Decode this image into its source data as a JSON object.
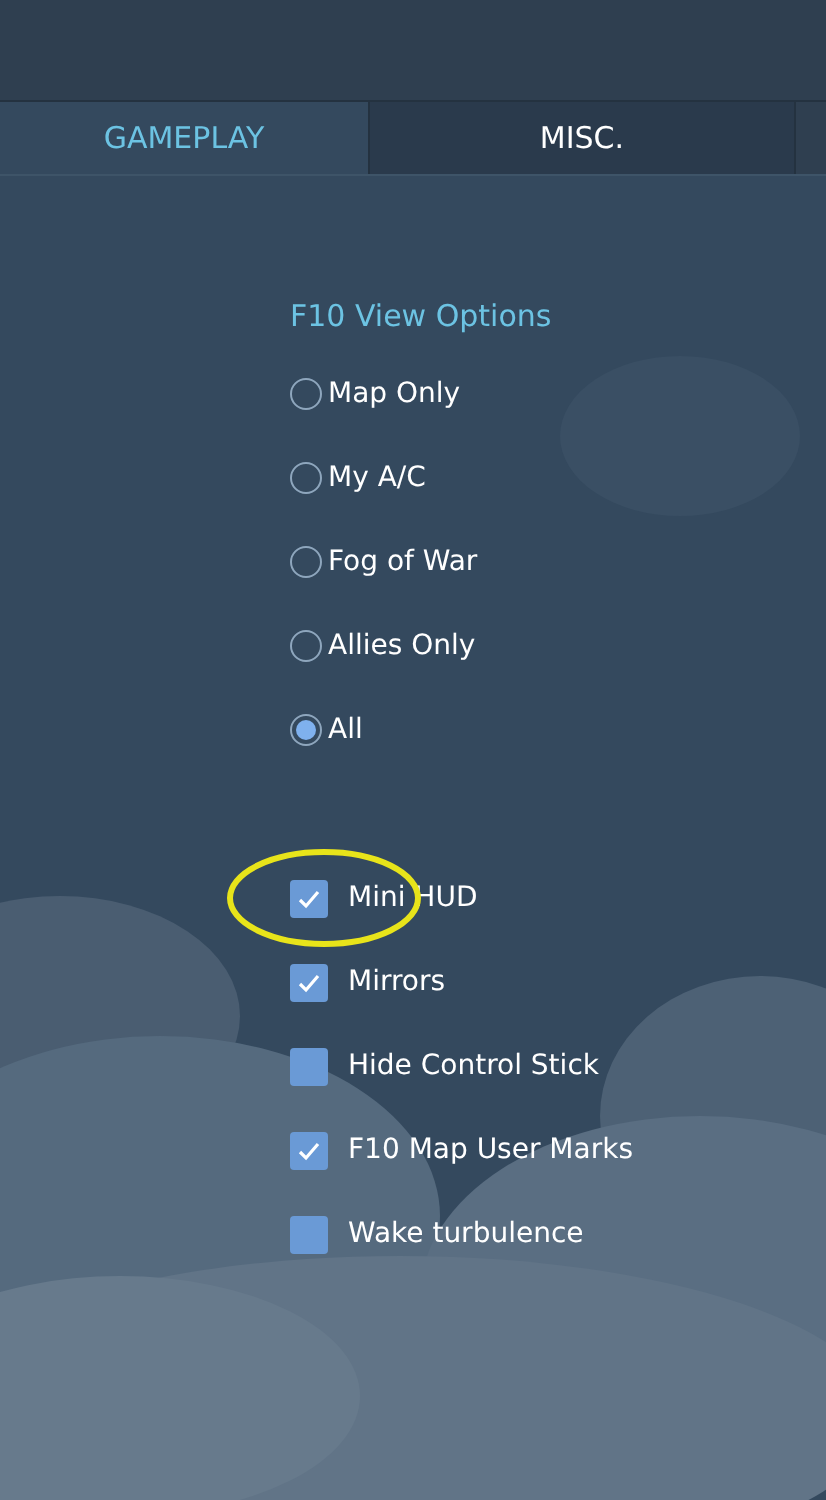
{
  "tabs": [
    {
      "label": "GAMEPLAY",
      "selected": true
    },
    {
      "label": "MISC.",
      "selected": false
    }
  ],
  "view_options": {
    "title": "F10 View Options",
    "options": [
      {
        "label": "Map Only",
        "selected": false
      },
      {
        "label": "My A/C",
        "selected": false
      },
      {
        "label": "Fog of War",
        "selected": false
      },
      {
        "label": "Allies Only",
        "selected": false
      },
      {
        "label": "All",
        "selected": true
      }
    ]
  },
  "checkboxes": [
    {
      "label": "Mini HUD",
      "checked": true,
      "circled": true
    },
    {
      "label": "Mirrors",
      "checked": true,
      "circled": false
    },
    {
      "label": "Hide Control Stick",
      "checked": false,
      "circled": false
    },
    {
      "label": "F10 Map User Marks",
      "checked": true,
      "circled": false
    },
    {
      "label": "Wake turbulence",
      "checked": false,
      "circled": false
    }
  ]
}
